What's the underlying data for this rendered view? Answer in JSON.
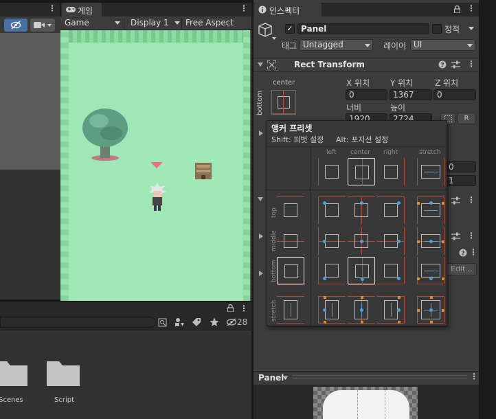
{
  "game_tab": {
    "title": "게임"
  },
  "game_toolbar": {
    "mode": "Game",
    "display": "Display 1",
    "aspect": "Free Aspect"
  },
  "inspector_tab": {
    "title": "인스펙터"
  },
  "gameobject": {
    "name": "Panel",
    "active": true,
    "static_label": "정적",
    "tag_label": "태그",
    "tag_value": "Untagged",
    "layer_label": "레이어",
    "layer_value": "UI"
  },
  "rect_transform": {
    "title": "Rect Transform",
    "anchor_horizontal": "center",
    "anchor_vertical": "bottom",
    "pos_x_label": "X 위치",
    "pos_x": "0",
    "pos_y_label": "Y 위치",
    "pos_y": "1367",
    "pos_z_label": "Z 위치",
    "pos_z": "0",
    "width_label": "너비",
    "width": "1920",
    "height_label": "높이",
    "height": "2724",
    "r_button": "R",
    "partial_values": [
      "0",
      "1"
    ]
  },
  "anchor_presets": {
    "title": "앵커 프리셋",
    "hint_shift": "Shift: 피벗 설정",
    "hint_alt": "Alt: 포지션 설정",
    "columns": [
      "left",
      "center",
      "right",
      "stretch"
    ],
    "rows": [
      "top",
      "middle",
      "bottom",
      "stretch"
    ],
    "selected": "bottom-center"
  },
  "edit_button": "Edit...",
  "project_panel": {
    "hidden_count": "28",
    "folders": [
      {
        "name": "Scenes"
      },
      {
        "name": "Script"
      }
    ]
  },
  "preview": {
    "title": "Panel"
  },
  "colors": {
    "accent": "#3a72b0",
    "game_bg": "#9fe8b6",
    "anchor_line": "#b24b3b",
    "anchor_dot": "#49a0d8",
    "pivot": "#e08b2a"
  }
}
